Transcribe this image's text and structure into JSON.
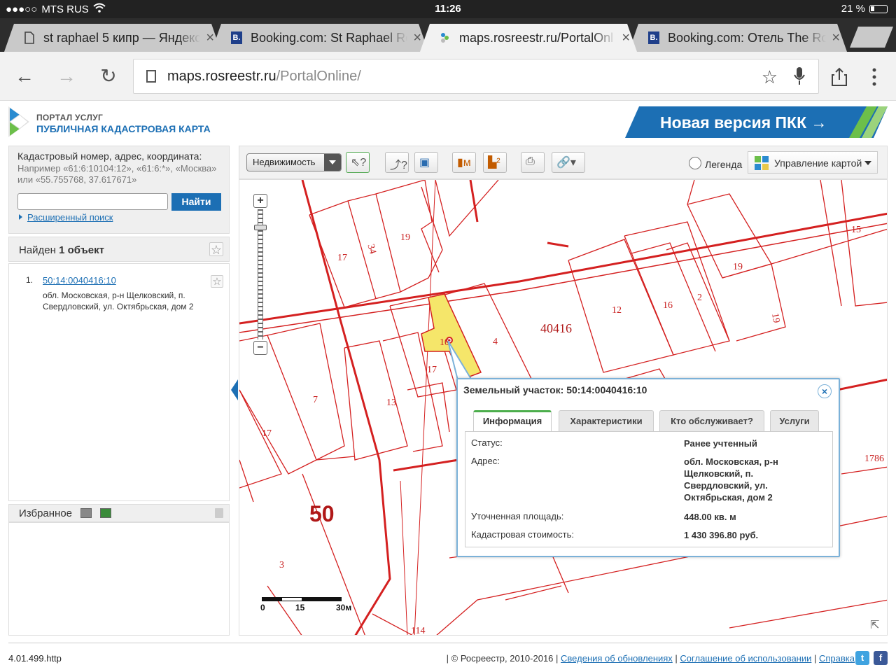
{
  "status_bar": {
    "carrier": "MTS RUS",
    "time": "11:26",
    "battery": "21 %"
  },
  "tabs": [
    {
      "title": "st raphael 5 кипр — Яндекс",
      "close": "×"
    },
    {
      "title": "Booking.com: St Raphael Re",
      "close": "×",
      "favicon": "B."
    },
    {
      "title": "maps.rosreestr.ru/PortalOnl",
      "close": "×"
    },
    {
      "title": "Booking.com: Отель The Ro",
      "close": "×",
      "favicon": "B."
    }
  ],
  "toolbar": {
    "url_host": "maps.rosreestr.ru",
    "url_path": "/PortalOnline/",
    "back": "←",
    "forward": "→",
    "reload": "↻",
    "star": "☆"
  },
  "header": {
    "portal_small": "ПОРТАЛ УСЛУГ",
    "portal_big": "ПУБЛИЧНАЯ КАДАСТРОВАЯ КАРТА",
    "new_version": "Новая версия ПКК →"
  },
  "search": {
    "head": "Кадастровый номер, адрес, координата:",
    "hint": "Например «61:6:10104:12», «61:6:*», «Москва» или «55.755768, 37.617671»",
    "value": "",
    "find_label": "Найти",
    "advanced": "Расширенный поиск"
  },
  "results": {
    "found_prefix": "Найден ",
    "found_count": "1 объект",
    "items": [
      {
        "num": "1.",
        "link": "50:14:0040416:10",
        "addr": "обл. Московская, р-н Щелковский, п. Свердловский, ул. Октябрьская, дом 2"
      }
    ]
  },
  "favorites": {
    "head": "Избранное"
  },
  "map_toolbar": {
    "layer": "Недвижимость",
    "legend": "Легенда",
    "map_control": "Управление картой"
  },
  "map": {
    "quarter_label": "40416",
    "district_label": "50",
    "parcel_labels": [
      "17",
      "34",
      "19",
      "15",
      "12",
      "16",
      "2",
      "19",
      "19",
      "4",
      "10",
      "17",
      "13",
      "7",
      "17",
      "3",
      "114",
      "1786"
    ],
    "scale": {
      "t0": "0",
      "t15": "15",
      "t30": "30м"
    }
  },
  "popup": {
    "title": "Земельный участок: 50:14:0040416:10",
    "close": "×",
    "tabs": [
      "Информация",
      "Характеристики",
      "Кто обслуживает?",
      "Услуги"
    ],
    "rows": [
      {
        "k": "Статус:",
        "v": "Ранее учтенный"
      },
      {
        "k": "Адрес:",
        "v": "обл. Московская, р-н Щелковский, п. Свердловский, ул. Октябрьская, дом 2"
      },
      {
        "k": "Уточненная площадь:",
        "v": "448.00 кв. м"
      },
      {
        "k": "Кадастровая стоимость:",
        "v": "1 430 396.80 руб."
      }
    ]
  },
  "footer": {
    "version": "4.01.499.http",
    "copyright": "| © Росреестр, 2010-2016 | ",
    "link1": "Сведения об обновлениях",
    "sep": " | ",
    "link2": "Соглашение об использовании",
    "link3": "Справка",
    "tail": " |"
  },
  "colors": {
    "accent": "#1c6fb4",
    "parcel_line": "#d42020",
    "parcel_fill": "#f5e66a",
    "popup_border": "#7bb1d8"
  }
}
